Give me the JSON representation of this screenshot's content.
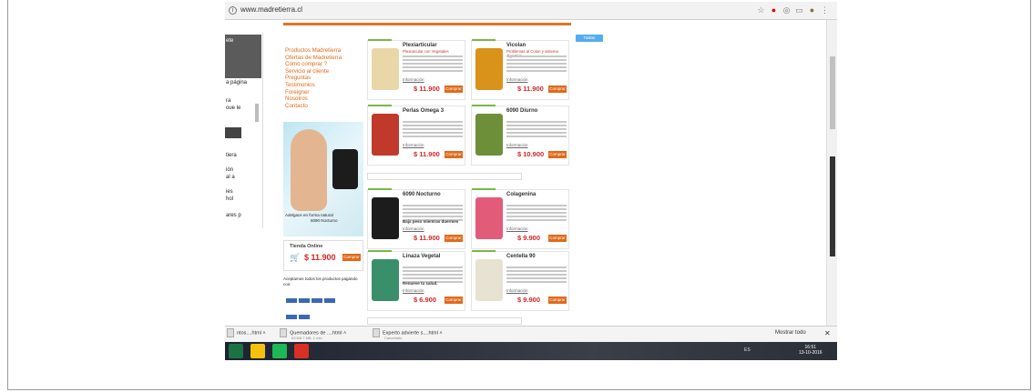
{
  "browser": {
    "url": "www.madretierra.cl",
    "icons": [
      "star-icon",
      "opera-icon",
      "extension-icon",
      "cast-icon",
      "account-icon",
      "menu-icon"
    ]
  },
  "left_panel": {
    "texts": [
      "ete",
      "a página",
      "ra",
      "oue le",
      "tiera",
      "ión",
      "al a",
      "ies",
      "hol",
      "ares p"
    ]
  },
  "menu": [
    "Productos Madretierra",
    "Ofertas de Madretierra",
    "Cómo comprar ?",
    "Servicio al cliente",
    "Preguntas",
    "Testimonios",
    "Foreigner",
    "Nosotros",
    "Contacto"
  ],
  "ad": {
    "caption": "Adelgace en forma natural",
    "product": "6090 Nocturno"
  },
  "tienda": {
    "label": "Tienda Online",
    "price": "$ 11.900",
    "button": "Comprar"
  },
  "payment": {
    "text": "Aceptamos todos los productos pagando con:"
  },
  "twitter": "Twitter",
  "products": [
    {
      "name": "Plexiarticular",
      "sub": "Plexiarcular con Vegetales",
      "price": "$ 11.900",
      "info": "Información",
      "buy": "Comprar",
      "color": "#e9d7a8"
    },
    {
      "name": "Vicolan",
      "sub": "Problemas al Colon y sistema digestivo",
      "price": "$ 11.900",
      "info": "Información",
      "buy": "Comprar",
      "color": "#d9921a"
    },
    {
      "name": "Perlas Omega 3",
      "sub": "",
      "price": "$ 11.900",
      "info": "Información",
      "buy": "Comprar",
      "color": "#c0392b"
    },
    {
      "name": "6090 Diurno",
      "sub": "",
      "price": "$ 10.900",
      "info": "Información",
      "buy": "Comprar",
      "color": "#6e8f3a"
    },
    {
      "name": "6090 Nocturno",
      "sub": "",
      "price": "$ 11.900",
      "info": "Información",
      "buy": "Comprar",
      "color": "#1c1c1c",
      "note": "Baja peso mientras duermes"
    },
    {
      "name": "Colagenina",
      "sub": "",
      "price": "$ 9.900",
      "info": "Información",
      "buy": "Comprar",
      "color": "#e25c7a"
    },
    {
      "name": "Linaza Vegetal",
      "sub": "",
      "price": "$ 6.900",
      "info": "Información",
      "buy": "Comprar",
      "color": "#3a8f6b",
      "note": "Renueve tu salud."
    },
    {
      "name": "Centella 90",
      "sub": "",
      "price": "$ 9.900",
      "info": "Información",
      "buy": "Comprar",
      "color": "#e8e2d2"
    }
  ],
  "downloads": [
    {
      "name": "ntos....html",
      "sub": ""
    },
    {
      "name": "Quemadores de ....html",
      "sub": "63.5/8.7 MB, 1 min"
    },
    {
      "name": "Experto advierte s....html",
      "sub": "Cancelado"
    }
  ],
  "downloads_show_all": "Mostrar todo",
  "taskbar": {
    "apps": [
      "excel-icon",
      "chrome-icon",
      "spotify-icon",
      "acrobat-icon"
    ],
    "app_colors": [
      "#1e7145",
      "#f4c20d",
      "#1db954",
      "#d93025"
    ],
    "tray": "ES",
    "time": "16:51",
    "date": "13-10-2016"
  }
}
